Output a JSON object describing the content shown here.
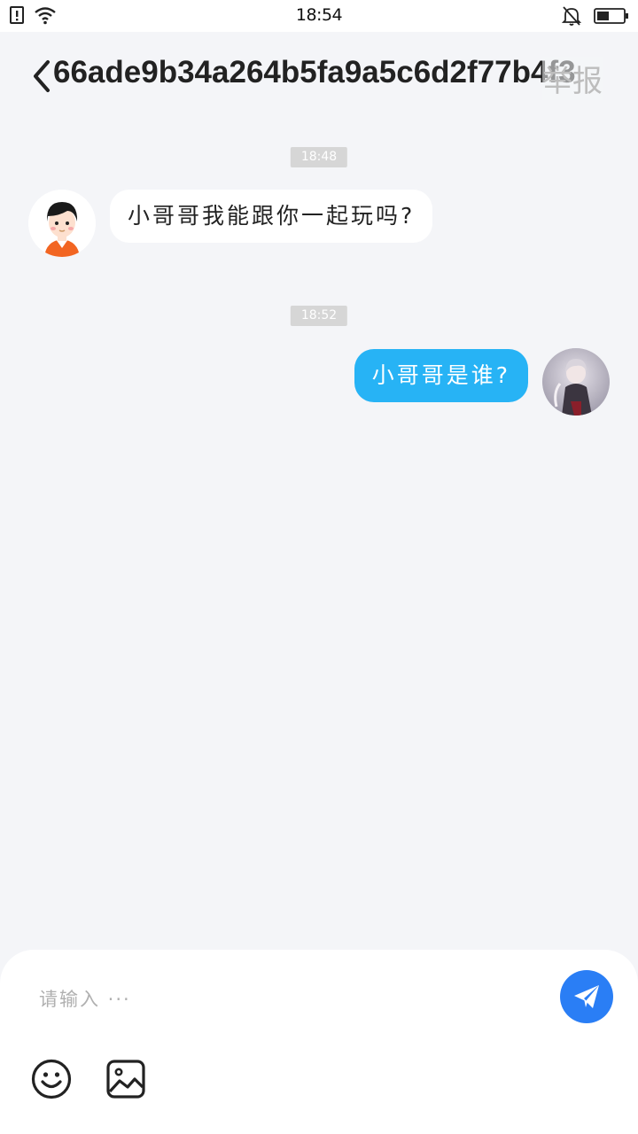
{
  "status_bar": {
    "time": "18:54",
    "icons": [
      "sim-alert-icon",
      "wifi-icon",
      "bell-muted-icon",
      "battery-icon"
    ],
    "battery_level": 0.45
  },
  "header": {
    "title": "66ade9b34a264b5fa9a5c6d2f77b4f3",
    "report_label": "举报",
    "back_icon": "back-chevron-icon"
  },
  "messages": [
    {
      "timestamp": "18:48",
      "direction": "received",
      "text": "小哥哥我能跟你一起玩吗?",
      "avatar": "cartoon-boy-avatar"
    },
    {
      "timestamp": "18:52",
      "direction": "sent",
      "text": "小哥哥是谁?",
      "avatar": "anime-character-avatar"
    }
  ],
  "input": {
    "placeholder": "请输入 ···",
    "value": ""
  },
  "toolbar": {
    "send_icon": "paper-plane-icon",
    "emoji_icon": "smiley-icon",
    "image_icon": "image-icon"
  },
  "colors": {
    "background": "#f4f5f8",
    "sent_bubble": "#27b3f5",
    "send_button": "#2a7ef5",
    "timestamp_bg": "#d6d6d6"
  }
}
